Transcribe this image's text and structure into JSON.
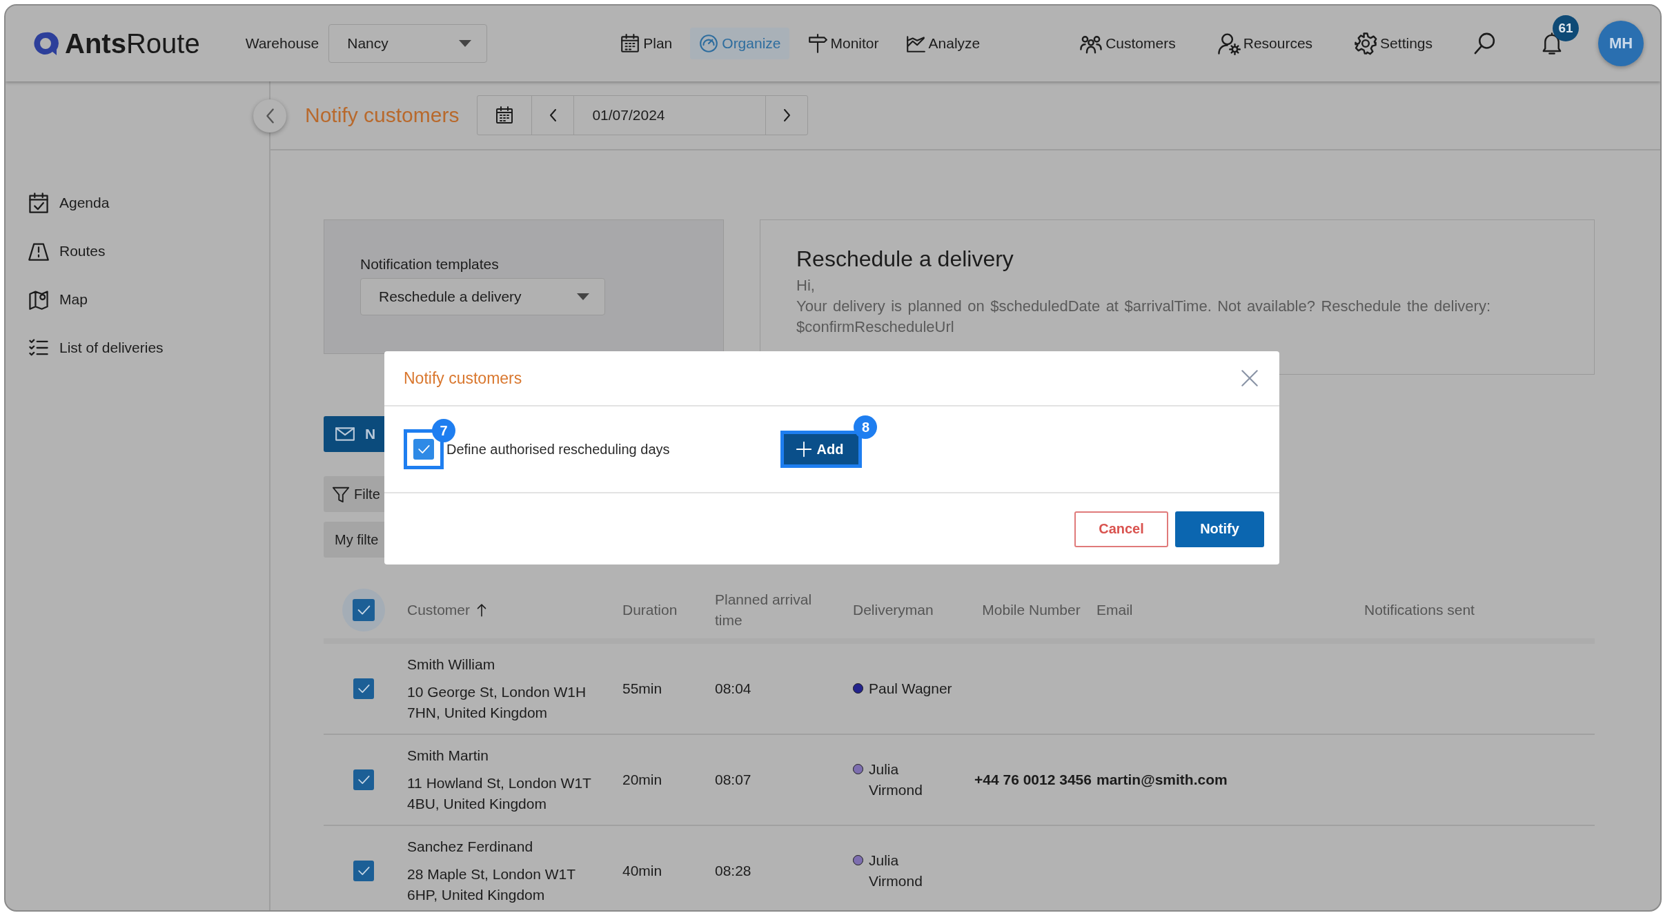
{
  "header": {
    "logo": {
      "bold": "Ants",
      "light": "Route"
    },
    "warehouse": {
      "label": "Warehouse",
      "value": "Nancy"
    },
    "nav": [
      {
        "label": "Plan",
        "selected": false
      },
      {
        "label": "Organize",
        "selected": true
      },
      {
        "label": "Monitor",
        "selected": false
      },
      {
        "label": "Analyze",
        "selected": false
      }
    ],
    "tools": [
      {
        "label": "Customers"
      },
      {
        "label": "Resources"
      },
      {
        "label": "Settings"
      }
    ],
    "notifications": {
      "count": "61"
    },
    "avatar": {
      "initials": "MH"
    }
  },
  "sidebar": {
    "items": [
      {
        "label": "Agenda"
      },
      {
        "label": "Routes"
      },
      {
        "label": "Map"
      },
      {
        "label": "List of deliveries"
      }
    ]
  },
  "toolbar": {
    "title": "Notify customers",
    "date": "01/07/2024"
  },
  "template_card": {
    "label": "Notification templates",
    "value": "Reschedule a delivery"
  },
  "preview": {
    "title": "Reschedule a delivery",
    "greeting": "Hi,",
    "body": "Your delivery is planned on $scheduledDate at $arrivalTime. Not available? Reschedule the delivery: $confirmRescheduleUrl"
  },
  "actions": {
    "notify": "N",
    "filter": "Filte",
    "my_filters": "My filte"
  },
  "table": {
    "all_selected": true,
    "columns": [
      {
        "label": "Customer",
        "sorted": true
      },
      {
        "label": "Duration",
        "sorted": false
      },
      {
        "label": "Planned arrival time",
        "sorted": false
      },
      {
        "label": "Deliveryman",
        "sorted": false
      },
      {
        "label": "Mobile Number",
        "sorted": false
      },
      {
        "label": "Email",
        "sorted": false
      },
      {
        "label": "Notifications sent",
        "sorted": false
      }
    ],
    "rows": [
      {
        "selected": true,
        "name": "Smith William",
        "address": "10 George St, London W1H 7HN, United Kingdom",
        "duration": "55min",
        "arrival": "08:04",
        "deliveryman": "Paul Wagner",
        "color": "#23238c"
      },
      {
        "selected": true,
        "name": "Smith Martin",
        "address": "11 Howland St, London W1T 4BU, United Kingdom",
        "duration": "20min",
        "arrival": "08:07",
        "deliveryman": "Julia Virmond",
        "color": "#7d6eaf",
        "mobile": "+44 76 0012 3456",
        "email": "martin@smith.com"
      },
      {
        "selected": true,
        "name": "Sanchez Ferdinand",
        "address": "28 Maple St, London W1T 6HP, United Kingdom",
        "duration": "40min",
        "arrival": "08:28",
        "deliveryman": "Julia Virmond",
        "color": "#7d6eaf"
      }
    ]
  },
  "modal": {
    "title": "Notify customers",
    "option": {
      "label": "Define authorised rescheduling days",
      "checked": true,
      "step": "7"
    },
    "add": {
      "label": "Add",
      "step": "8"
    },
    "buttons": [
      {
        "label": "Cancel",
        "kind": "secondary"
      },
      {
        "label": "Notify",
        "kind": "primary"
      }
    ]
  }
}
